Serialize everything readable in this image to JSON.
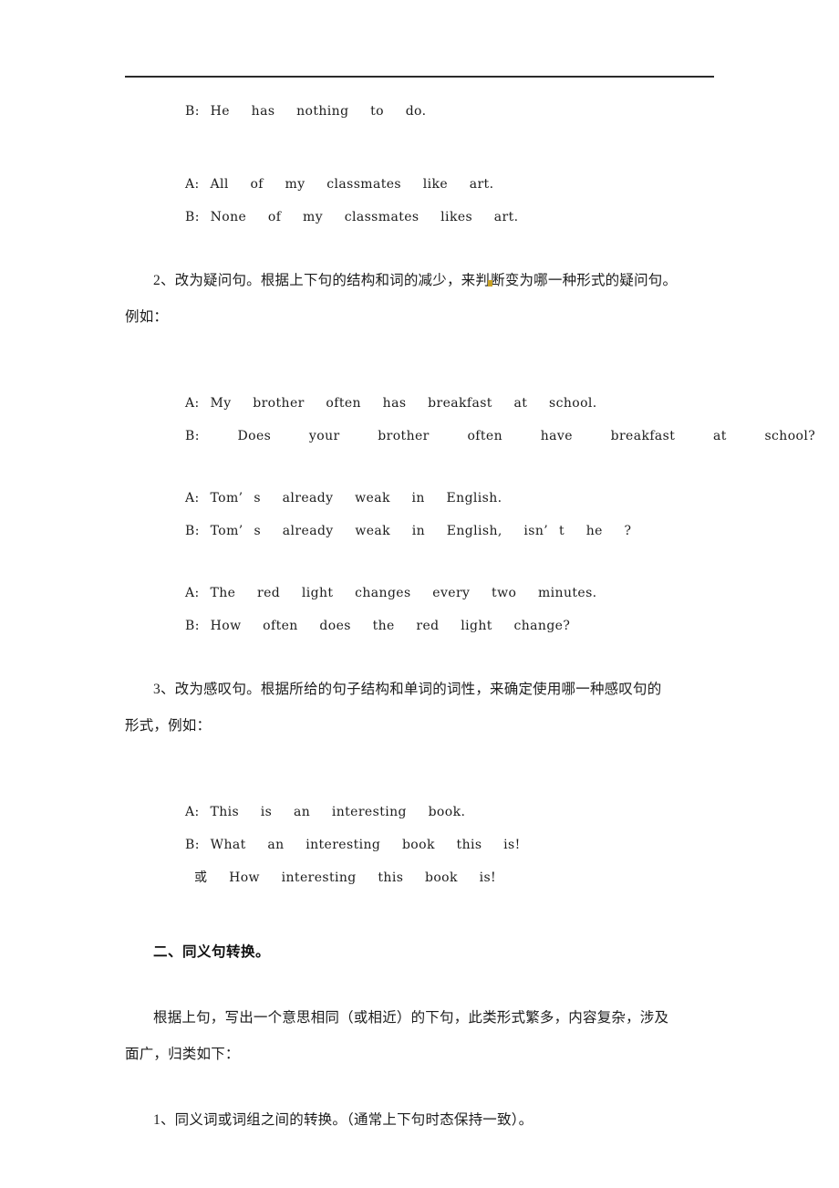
{
  "document": {
    "title": "初中英语 句型转换讲义",
    "background_color": "#ffffff",
    "text_color": "#1c1c1c",
    "rule_color": "#2b2b2b"
  },
  "dialogues": {
    "block1": {
      "line1": "B: He  has  nothing  to  do.",
      "line2": "A: All  of  my  classmates  like  art.",
      "line3": "B: None  of  my  classmates  likes  art."
    },
    "block2": {
      "line1": "A: My  brother  often  has  breakfast  at  school.",
      "line2": "B:  Does  your  brother  often  have  breakfast  at  school?",
      "line3": "A: Tom’ s  already  weak  in  English.",
      "line4": "B: Tom’ s  already  weak  in  English,  isn’ t  he  ?",
      "line5": "A: The  red  light  changes  every  two  minutes.",
      "line6": "B: How  often  does  the  red  light  change?"
    },
    "block3": {
      "line1": "A: This  is  an  interesting  book.",
      "line2": "B: What  an  interesting  book  this  is!",
      "line3": "或  How  interesting  this  book  is!"
    }
  },
  "sections": {
    "item2_part_a": "2、改为疑问句。根据上下句的结构和词的减少，来判",
    "item2_part_b": "断变为哪一种形式的疑问句。",
    "item2_cont": "例如：",
    "item3": "3、改为感叹句。根据所给的句子结构和单词的词性，来确定使用哪一种感叹句的",
    "item3_cont": "形式，例如：",
    "heading2": "二、同义句转换。",
    "intro": "根据上句，写出一个意思相同（或相近）的下句，此类形式繁多，内容复杂，涉及",
    "intro_cont": "面广，归类如下：",
    "item1_syn": "1、同义词或词组之间的转换。（通常上下句时态保持一致）。"
  }
}
